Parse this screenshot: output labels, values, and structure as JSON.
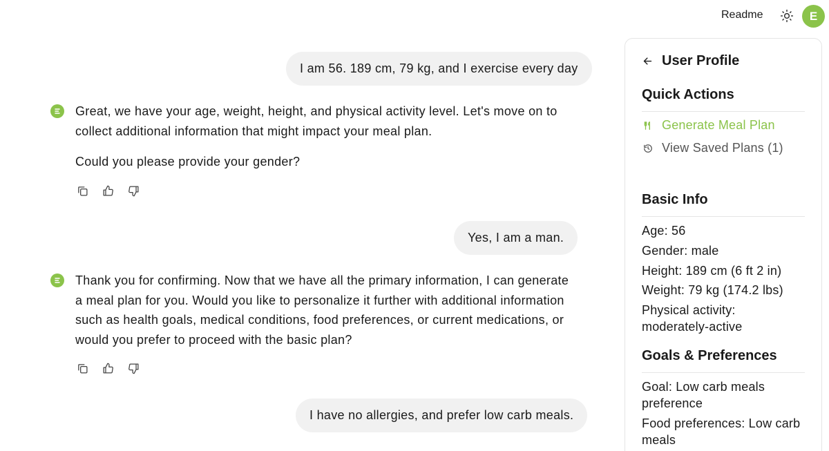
{
  "header": {
    "readme_label": "Readme",
    "theme_icon": "sun-icon",
    "avatar_initial": "E",
    "accent_color": "#8bc34a"
  },
  "chat": {
    "user_msg_1": "I am 56. 189 cm, 79 kg, and I exercise every day",
    "bot_msg_1_p1": "Great, we have your age, weight, height, and physical activity level. Let's move on to collect additional information that might impact your meal plan.",
    "bot_msg_1_p2": "Could you please provide your gender?",
    "user_msg_2": "Yes, I am a man.",
    "bot_msg_2": "Thank you for confirming. Now that we have all the primary information, I can generate a meal plan for you. Would you like to personalize it further with additional information such as health goals, medical conditions, food preferences, or current medications, or would you prefer to proceed with the basic plan?",
    "user_msg_3": "I have no allergies, and prefer low carb meals.",
    "action_icons": [
      "copy-icon",
      "thumbs-up-icon",
      "thumbs-down-icon"
    ]
  },
  "profile": {
    "title": "User Profile",
    "quick_actions_title": "Quick Actions",
    "generate_label": "Generate Meal Plan",
    "saved_label": "View Saved Plans (1)",
    "basic_info_title": "Basic Info",
    "age": "Age: 56",
    "gender": "Gender: male",
    "height": "Height: 189 cm (6 ft 2 in)",
    "weight": "Weight: 79 kg (174.2 lbs)",
    "activity": "Physical activity: moderately-active",
    "goals_title": "Goals & Preferences",
    "goal": "Goal: Low carb meals preference",
    "food_pref": "Food preferences: Low carb meals"
  }
}
